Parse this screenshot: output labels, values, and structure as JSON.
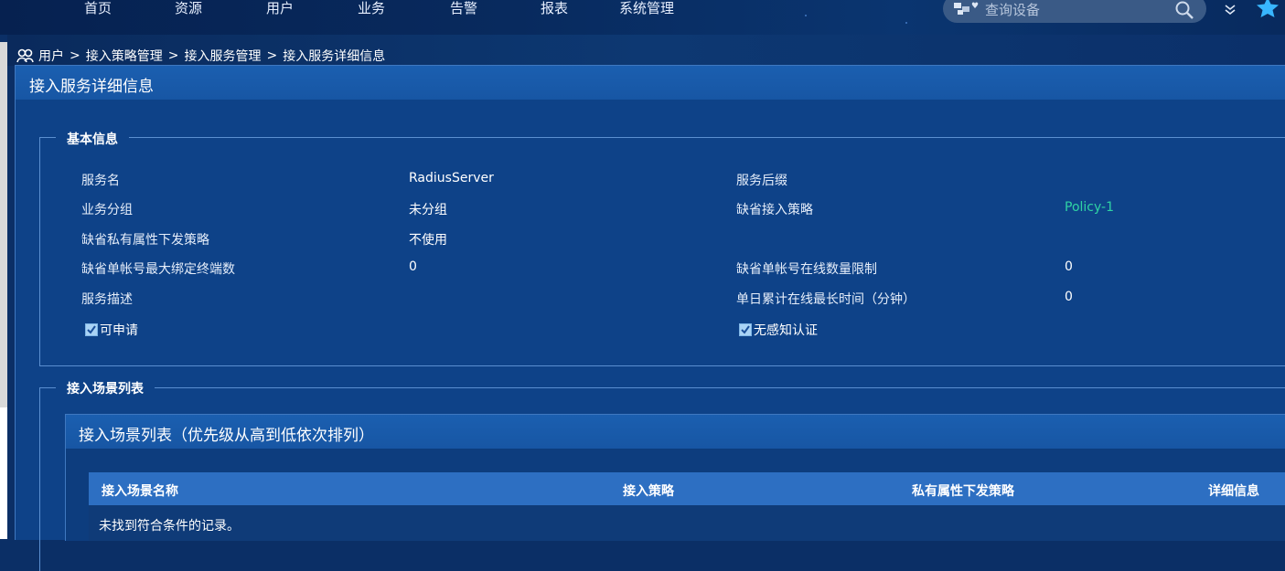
{
  "nav": {
    "items": [
      "首页",
      "资源",
      "用户",
      "业务",
      "告警",
      "报表",
      "系统管理"
    ],
    "search": {
      "placeholder": "查询设备"
    }
  },
  "breadcrumb": [
    "用户",
    "接入策略管理",
    "接入服务管理",
    "接入服务详细信息"
  ],
  "breadcrumb_sep": ">",
  "panel": {
    "title": "接入服务详细信息",
    "basic": {
      "legend": "基本信息",
      "rows": [
        {
          "label": "服务名",
          "value": "RadiusServer",
          "label2": "服务后缀",
          "value2": ""
        },
        {
          "label": "业务分组",
          "value": "未分组",
          "label2": "缺省接入策略",
          "value2": "Policy-1"
        },
        {
          "label": "缺省私有属性下发策略",
          "value": "不使用",
          "label2": "",
          "value2": ""
        },
        {
          "label": "缺省单帐号最大绑定终端数",
          "value": "0",
          "label2": "缺省单帐号在线数量限制",
          "value2": "0"
        },
        {
          "label": "服务描述",
          "value": "",
          "label2": "单日累计在线最长时间（分钟）",
          "value2": "0"
        }
      ],
      "checkboxes": [
        {
          "label": "可申请",
          "checked": true
        },
        {
          "label": "无感知认证",
          "checked": true
        }
      ]
    },
    "scenes": {
      "legend": "接入场景列表",
      "table_title": "接入场景列表（优先级从高到低依次排列）",
      "columns": [
        "接入场景名称",
        "接入策略",
        "私有属性下发策略",
        "详细信息"
      ],
      "rows": [],
      "empty_message": "未找到符合条件的记录。"
    }
  },
  "colors": {
    "link": "#2fd3a4",
    "header_bar": "#1b5fb0",
    "table_head": "#2d6fc2"
  }
}
